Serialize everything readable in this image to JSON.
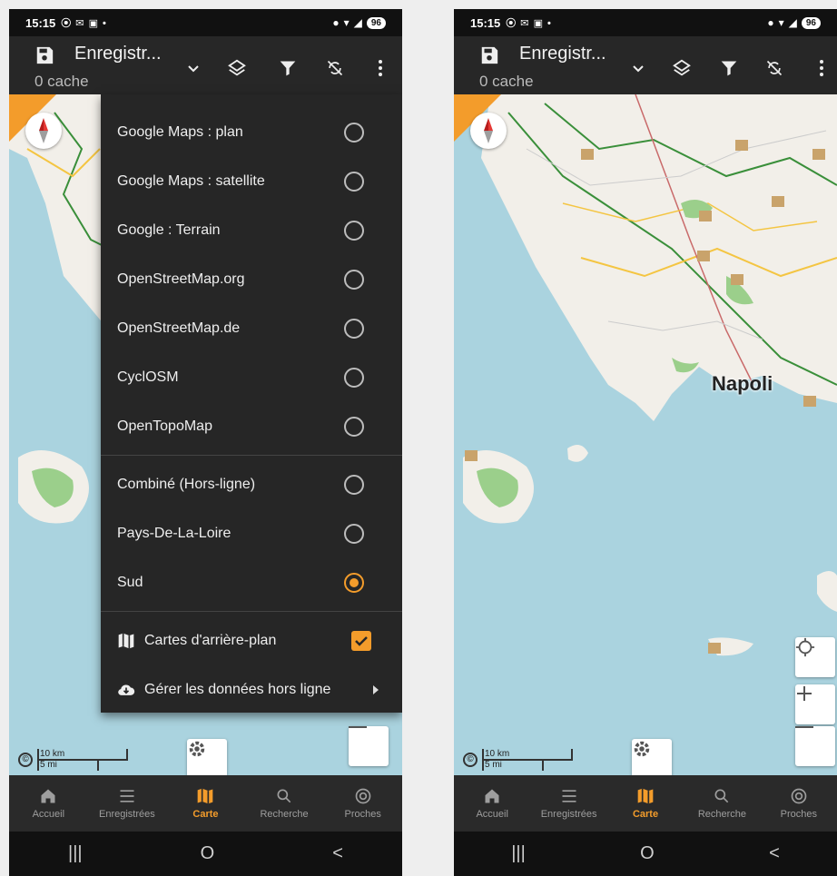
{
  "status": {
    "time": "15:15",
    "notifications": "⦿ ✉ ▣ •",
    "battery": "96"
  },
  "topbar": {
    "title": "Enregistr...",
    "subtitle": "0 cache"
  },
  "map_layers_menu": {
    "items": [
      {
        "label": "Google Maps : plan",
        "selected": false
      },
      {
        "label": "Google Maps : satellite",
        "selected": false
      },
      {
        "label": "Google : Terrain",
        "selected": false
      },
      {
        "label": "OpenStreetMap.org",
        "selected": false
      },
      {
        "label": "OpenStreetMap.de",
        "selected": false
      },
      {
        "label": "CyclOSM",
        "selected": false
      },
      {
        "label": "OpenTopoMap",
        "selected": false
      },
      {
        "label": "Combiné (Hors-ligne)",
        "selected": false
      },
      {
        "label": "Pays-De-La-Loire",
        "selected": false
      },
      {
        "label": "Sud",
        "selected": true
      }
    ],
    "background_maps": {
      "label": "Cartes d'arrière-plan",
      "checked": true
    },
    "offline_data": {
      "label": "Gérer les données hors ligne"
    }
  },
  "map": {
    "scale_km": "10 km",
    "scale_mi": "5 mi",
    "copyright": "©",
    "city_label": "Napoli"
  },
  "nav": {
    "items": [
      {
        "label": "Accueil",
        "active": false
      },
      {
        "label": "Enregistrées",
        "active": false
      },
      {
        "label": "Carte",
        "active": true
      },
      {
        "label": "Recherche",
        "active": false
      },
      {
        "label": "Proches",
        "active": false
      }
    ]
  },
  "system_nav": {
    "recents": "|||",
    "home": "O",
    "back": "<"
  },
  "colors": {
    "accent": "#f39c2b",
    "toolbar": "#272727",
    "sea": "#aad3df",
    "land": "#f2efe9"
  }
}
